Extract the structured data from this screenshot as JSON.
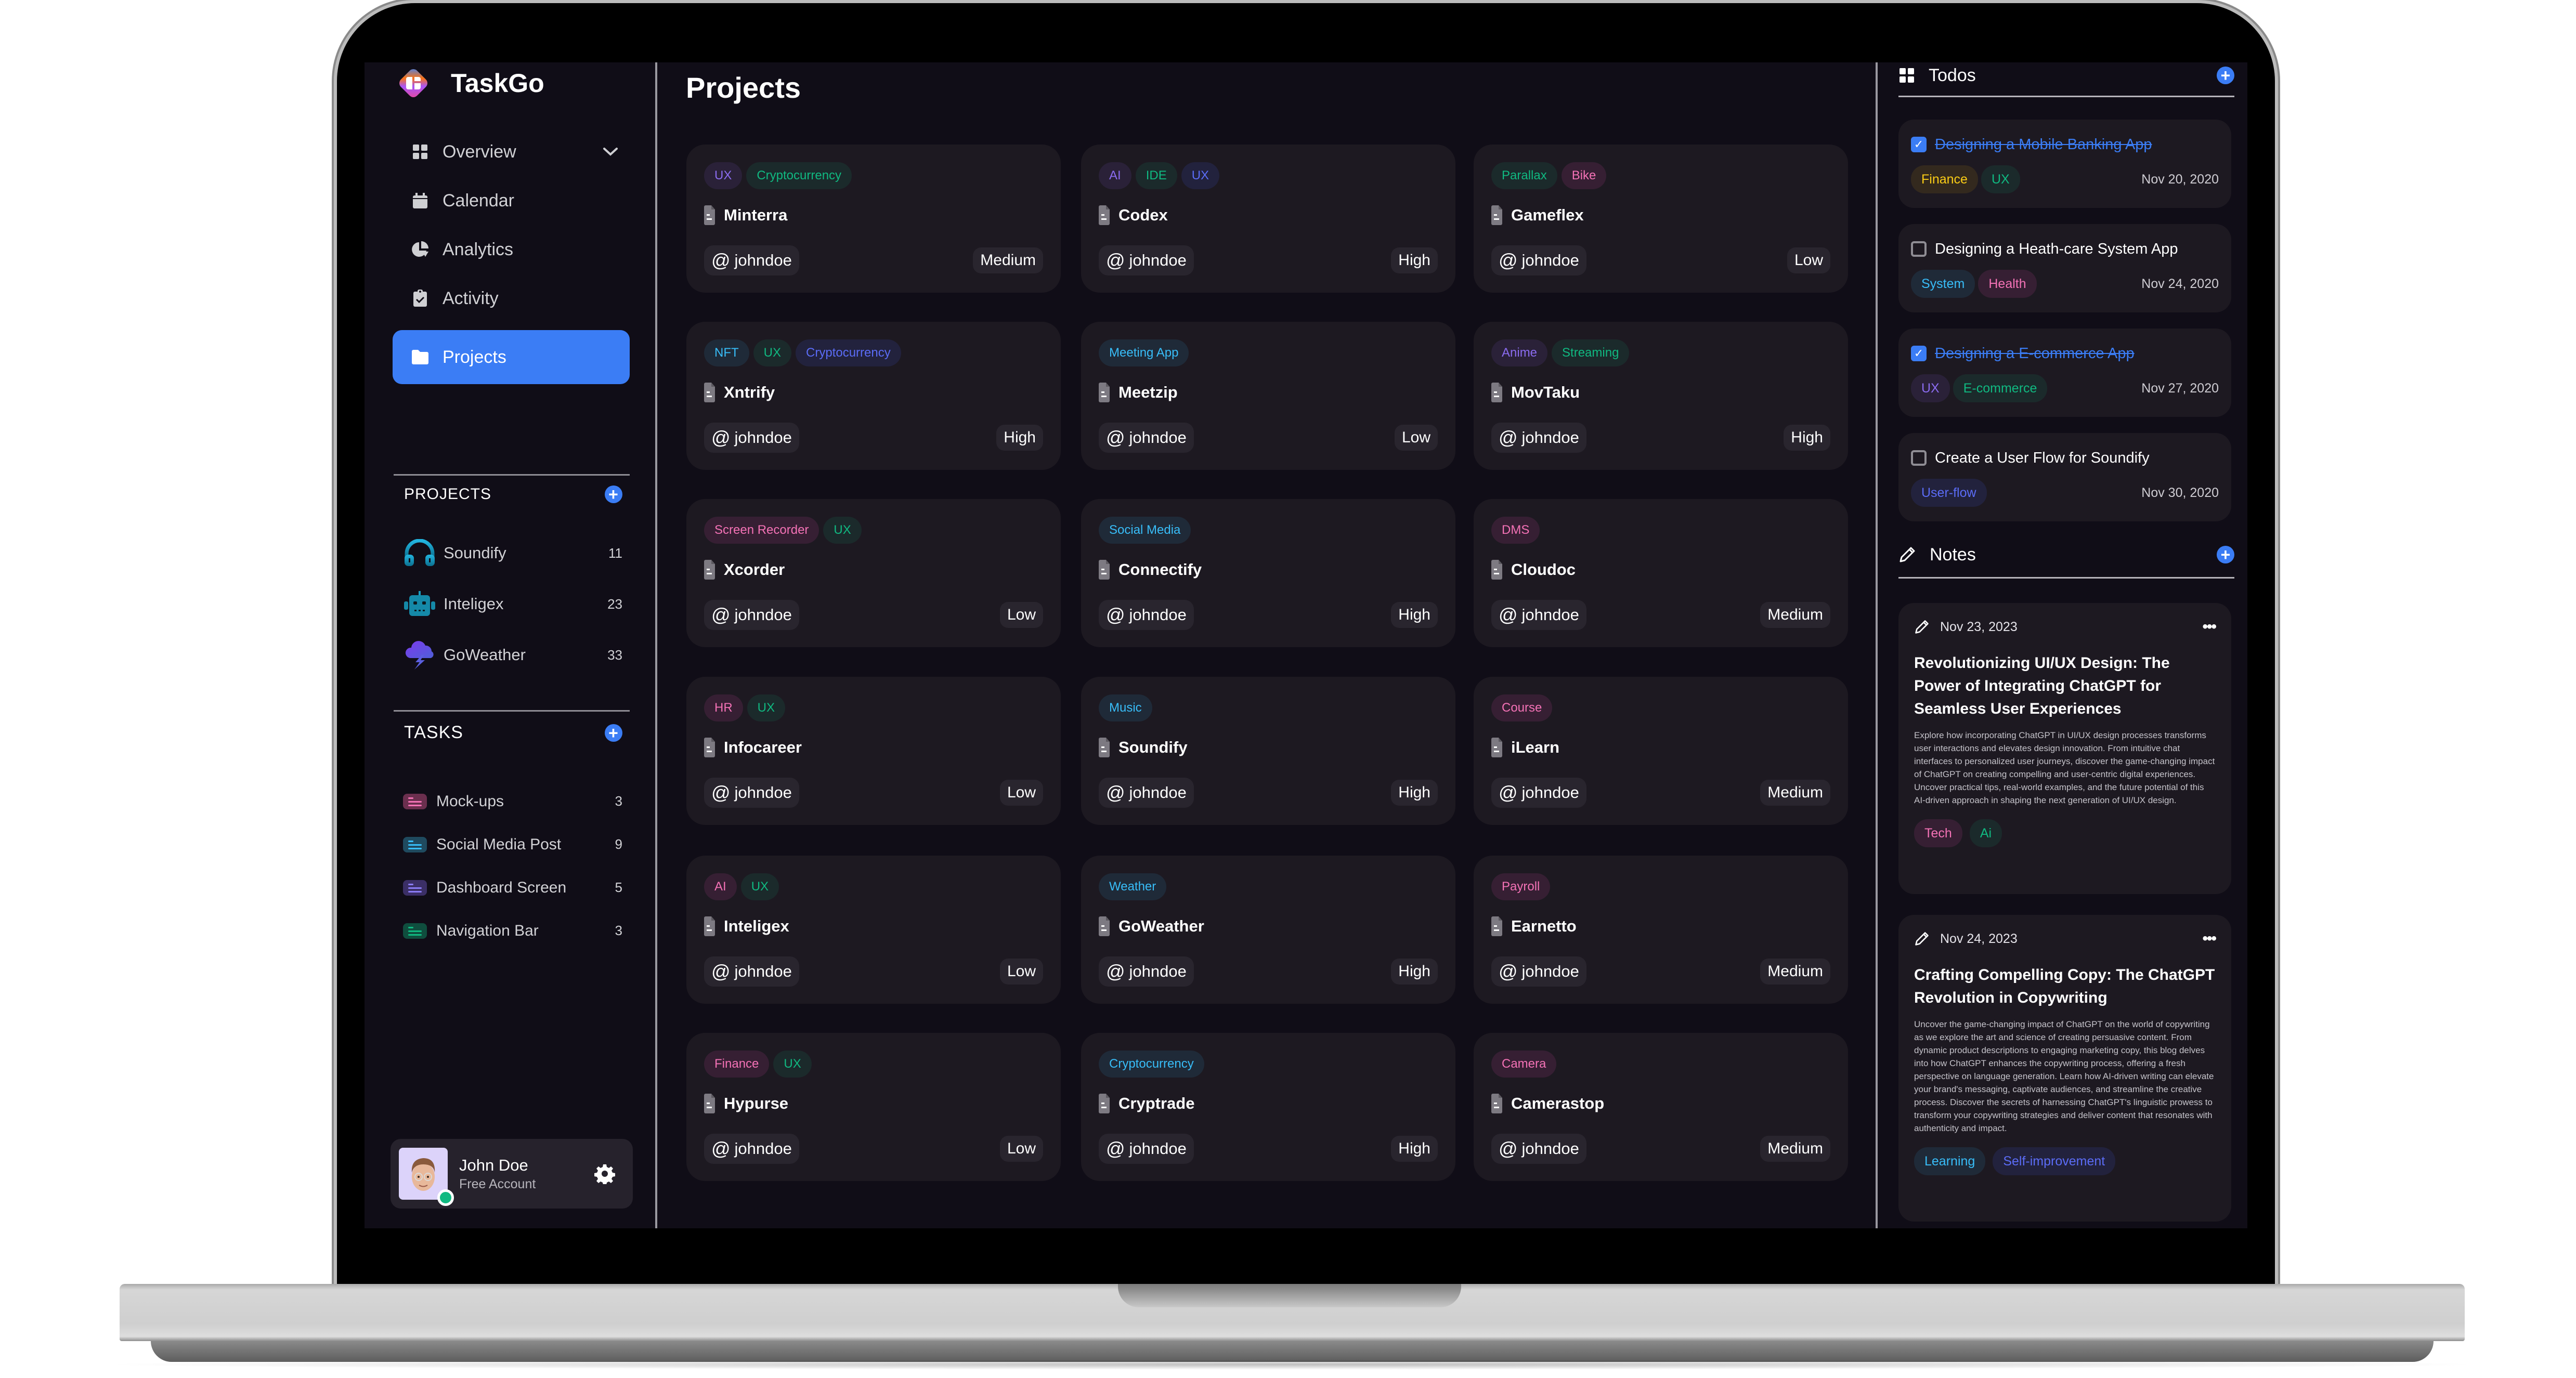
{
  "app": {
    "name": "TaskGo",
    "accent_color": "#3b7df5"
  },
  "sidebar": {
    "nav": [
      {
        "label": "Overview",
        "icon": "grid-icon",
        "has_chevron": true
      },
      {
        "label": "Calendar",
        "icon": "calendar-icon"
      },
      {
        "label": "Analytics",
        "icon": "pie-chart-icon"
      },
      {
        "label": "Activity",
        "icon": "clipboard-check-icon"
      },
      {
        "label": "Projects",
        "icon": "folder-icon",
        "active": true
      }
    ],
    "projects_heading": "PROJECTS",
    "projects": [
      {
        "name": "Soundify",
        "count": "11",
        "icon": "headphones-icon"
      },
      {
        "name": "Inteligex",
        "count": "23",
        "icon": "robot-icon"
      },
      {
        "name": "GoWeather",
        "count": "33",
        "icon": "storm-cloud-icon"
      }
    ],
    "tasks_heading": "TASKS",
    "tasks": [
      {
        "name": "Mock-ups",
        "count": "3",
        "color": "#f472b6",
        "bg": "#6b2f4e"
      },
      {
        "name": "Social Media Post",
        "count": "9",
        "color": "#38bdf8",
        "bg": "#1f4a5f"
      },
      {
        "name": "Dashboard Screen",
        "count": "5",
        "color": "#8b7cf6",
        "bg": "#3b2f66"
      },
      {
        "name": "Navigation Bar",
        "count": "3",
        "color": "#10b981",
        "bg": "#0f4e3e"
      }
    ],
    "user": {
      "name": "John Doe",
      "plan": "Free Account",
      "status": "online"
    }
  },
  "main": {
    "title": "Projects",
    "cards": [
      {
        "name": "Minterra",
        "tags": [
          {
            "label": "UX",
            "color": "purple"
          },
          {
            "label": "Cryptocurrency",
            "color": "green"
          }
        ],
        "owner": "johndoe",
        "priority": "Medium"
      },
      {
        "name": "Codex",
        "tags": [
          {
            "label": "AI",
            "color": "purple"
          },
          {
            "label": "IDE",
            "color": "green"
          },
          {
            "label": "UX",
            "color": "indigo"
          }
        ],
        "owner": "johndoe",
        "priority": "High"
      },
      {
        "name": "Gameflex",
        "tags": [
          {
            "label": "Parallax",
            "color": "green"
          },
          {
            "label": "Bike",
            "color": "pink"
          }
        ],
        "owner": "johndoe",
        "priority": "Low"
      },
      {
        "name": "Xntrify",
        "tags": [
          {
            "label": "NFT",
            "color": "cyan"
          },
          {
            "label": "UX",
            "color": "green"
          },
          {
            "label": "Cryptocurrency",
            "color": "indigo"
          }
        ],
        "owner": "johndoe",
        "priority": "High"
      },
      {
        "name": "Meetzip",
        "tags": [
          {
            "label": "Meeting App",
            "color": "cyan"
          }
        ],
        "owner": "johndoe",
        "priority": "Low"
      },
      {
        "name": "MovTaku",
        "tags": [
          {
            "label": "Anime",
            "color": "purple"
          },
          {
            "label": "Streaming",
            "color": "green"
          }
        ],
        "owner": "johndoe",
        "priority": "High"
      },
      {
        "name": "Xcorder",
        "tags": [
          {
            "label": "Screen Recorder",
            "color": "pink"
          },
          {
            "label": "UX",
            "color": "green"
          }
        ],
        "owner": "johndoe",
        "priority": "Low"
      },
      {
        "name": "Connectify",
        "tags": [
          {
            "label": "Social Media",
            "color": "cyan"
          }
        ],
        "owner": "johndoe",
        "priority": "High"
      },
      {
        "name": "Cloudoc",
        "tags": [
          {
            "label": "DMS",
            "color": "pink"
          }
        ],
        "owner": "johndoe",
        "priority": "Medium"
      },
      {
        "name": "Infocareer",
        "tags": [
          {
            "label": "HR",
            "color": "pink"
          },
          {
            "label": "UX",
            "color": "green"
          }
        ],
        "owner": "johndoe",
        "priority": "Low"
      },
      {
        "name": "Soundify",
        "tags": [
          {
            "label": "Music",
            "color": "cyan"
          }
        ],
        "owner": "johndoe",
        "priority": "High"
      },
      {
        "name": "iLearn",
        "tags": [
          {
            "label": "Course",
            "color": "pink"
          }
        ],
        "owner": "johndoe",
        "priority": "Medium"
      },
      {
        "name": "Inteligex",
        "tags": [
          {
            "label": "AI",
            "color": "pink"
          },
          {
            "label": "UX",
            "color": "green"
          }
        ],
        "owner": "johndoe",
        "priority": "Low"
      },
      {
        "name": "GoWeather",
        "tags": [
          {
            "label": "Weather",
            "color": "cyan"
          }
        ],
        "owner": "johndoe",
        "priority": "High"
      },
      {
        "name": "Earnetto",
        "tags": [
          {
            "label": "Payroll",
            "color": "pink"
          }
        ],
        "owner": "johndoe",
        "priority": "Medium"
      },
      {
        "name": "Hypurse",
        "tags": [
          {
            "label": "Finance",
            "color": "pink"
          },
          {
            "label": "UX",
            "color": "green"
          }
        ],
        "owner": "johndoe",
        "priority": "Low"
      },
      {
        "name": "Cryptrade",
        "tags": [
          {
            "label": "Cryptocurrency",
            "color": "cyan"
          }
        ],
        "owner": "johndoe",
        "priority": "High"
      },
      {
        "name": "Camerastop",
        "tags": [
          {
            "label": "Camera",
            "color": "pink"
          }
        ],
        "owner": "johndoe",
        "priority": "Medium"
      }
    ]
  },
  "tag_colors": {
    "purple": {
      "fg": "#8b6cf0",
      "bg": "#2a2138"
    },
    "green": {
      "fg": "#10b981",
      "bg": "#1b2a2b"
    },
    "indigo": {
      "fg": "#5b6cf6",
      "bg": "#22223d"
    },
    "cyan": {
      "fg": "#38bdf8",
      "bg": "#1f2a38"
    },
    "pink": {
      "fg": "#f472b6",
      "bg": "#361f33"
    },
    "yellow": {
      "fg": "#facc15",
      "bg": "#33291e"
    }
  },
  "todos": {
    "heading": "Todos",
    "items": [
      {
        "title": "Designing a Mobile Banking App",
        "done": true,
        "tags": [
          {
            "label": "Finance",
            "color": "yellow"
          },
          {
            "label": "UX",
            "color": "green"
          }
        ],
        "date": "Nov 20, 2020"
      },
      {
        "title": "Designing a Heath-care System App",
        "done": false,
        "tags": [
          {
            "label": "System",
            "color": "cyan"
          },
          {
            "label": "Health",
            "color": "pink"
          }
        ],
        "date": "Nov 24, 2020"
      },
      {
        "title": "Designing a E-commerce App",
        "done": true,
        "tags": [
          {
            "label": "UX",
            "color": "purple"
          },
          {
            "label": "E-commerce",
            "color": "green"
          }
        ],
        "date": "Nov 27, 2020"
      },
      {
        "title": "Create a User Flow for Soundify",
        "done": false,
        "tags": [
          {
            "label": "User-flow",
            "color": "indigo"
          }
        ],
        "date": "Nov 30, 2020"
      }
    ]
  },
  "notes": {
    "heading": "Notes",
    "items": [
      {
        "date": "Nov 23, 2023",
        "title": "Revolutionizing UI/UX Design: The Power of Integrating ChatGPT for Seamless User Experiences",
        "body": "Explore how incorporating ChatGPT in UI/UX design processes transforms user interactions and elevates design innovation. From intuitive chat interfaces to personalized user journeys, discover the game-changing impact of ChatGPT on creating compelling and user-centric digital experiences. Uncover practical tips, real-world examples, and the future potential of this AI-driven approach in shaping the next generation of UI/UX design.",
        "tags": [
          {
            "label": "Tech",
            "color": "pink"
          },
          {
            "label": "Ai",
            "color": "green"
          }
        ]
      },
      {
        "date": "Nov 24, 2023",
        "title": "Crafting Compelling Copy: The ChatGPT Revolution in Copywriting",
        "body": "Uncover the game-changing impact of ChatGPT on the world of copywriting as we explore the art and science of creating persuasive content. From dynamic product descriptions to engaging marketing copy, this blog delves into how ChatGPT enhances the copywriting process, offering a fresh perspective on language generation. Learn how AI-driven writing can elevate your brand's messaging, captivate audiences, and streamline the creative process. Discover the secrets of harnessing ChatGPT's linguistic prowess to transform your copywriting strategies and deliver content that resonates with authenticity and impact.",
        "tags": [
          {
            "label": "Learning",
            "color": "cyan"
          },
          {
            "label": "Self-improvement",
            "color": "indigo"
          }
        ]
      }
    ]
  }
}
